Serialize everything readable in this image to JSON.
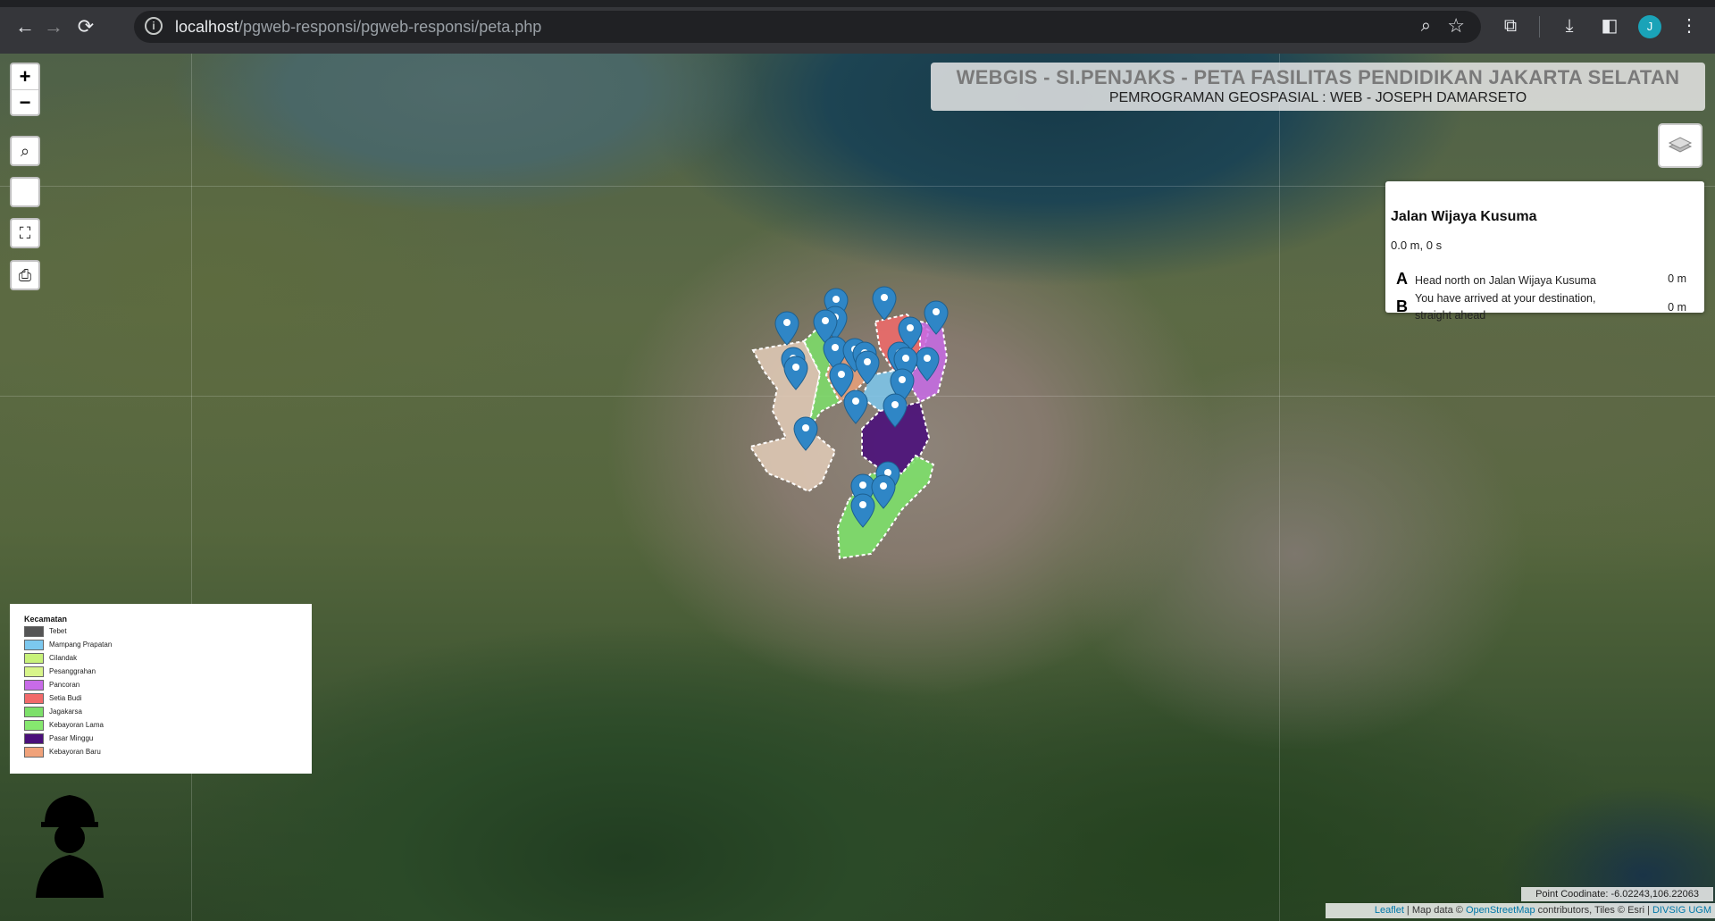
{
  "browser": {
    "url_host": "localhost",
    "url_path": "/pgweb-responsi/pgweb-responsi/peta.php",
    "profile_initial": "J"
  },
  "map": {
    "title": "WEBGIS - SI.PENJAKS - PETA FASILITAS PENDIDIKAN JAKARTA SELATAN",
    "subtitle": "PEMROGRAMAN GEOSPASIAL : WEB - JOSEPH DAMARSETO",
    "zoom_in": "+",
    "zoom_out": "−"
  },
  "routing": {
    "name": "Jalan Wijaya Kusuma",
    "summary": "0.0 m, 0 s",
    "steps": [
      {
        "letter": "A",
        "text": "Head north on Jalan Wijaya Kusuma",
        "distance": "0 m"
      },
      {
        "letter": "B",
        "text": "You have arrived at your destination, straight ahead",
        "distance": "0 m"
      }
    ]
  },
  "legend": {
    "title": "Kecamatan",
    "items": [
      {
        "label": "Tebet",
        "color": "#555555"
      },
      {
        "label": "Mampang Prapatan",
        "color": "#7cc8ef"
      },
      {
        "label": "Cilandak",
        "color": "#c8f27a"
      },
      {
        "label": "Pesanggrahan",
        "color": "#d8f58a"
      },
      {
        "label": "Pancoran",
        "color": "#c86be8"
      },
      {
        "label": "Setia Budi",
        "color": "#f26a6a"
      },
      {
        "label": "Jagakarsa",
        "color": "#7de06a"
      },
      {
        "label": "Kebayoran Lama",
        "color": "#86e86f"
      },
      {
        "label": "Pasar Minggu",
        "color": "#4a0f7a"
      },
      {
        "label": "Kebayoran Baru",
        "color": "#f0a27a"
      }
    ]
  },
  "footer": {
    "coordinate": "Point Coodinate: -6.02243,106.22063",
    "attrib_leaflet": "Leaflet",
    "attrib_mapdata": " | Map data © ",
    "attrib_osm": "OpenStreetMap",
    "attrib_tiles": " contributors, Tiles © Esri | ",
    "attrib_divsig": "DIVSIG UGM"
  }
}
